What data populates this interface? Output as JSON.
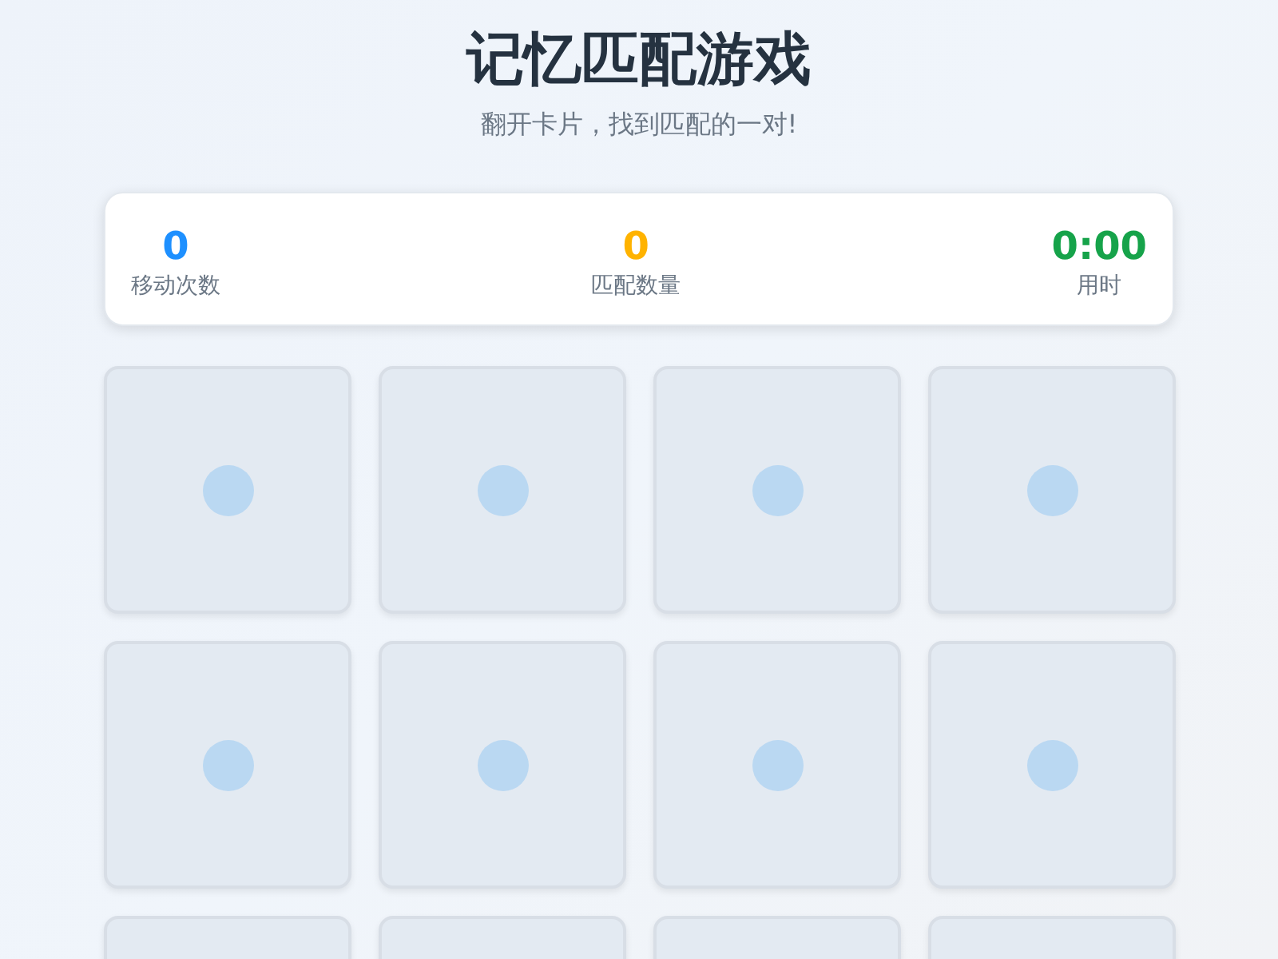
{
  "header": {
    "title": "记忆匹配游戏",
    "subtitle": "翻开卡片，找到匹配的一对!"
  },
  "stats": [
    {
      "value": "0",
      "label": "移动次数",
      "color": "#1e90ff"
    },
    {
      "value": "0",
      "label": "匹配数量",
      "color": "#ffb300"
    },
    {
      "value": "0:00",
      "label": "用时",
      "color": "#16a34a"
    }
  ],
  "cards": [
    {
      "flipped": false
    },
    {
      "flipped": false
    },
    {
      "flipped": false
    },
    {
      "flipped": false
    },
    {
      "flipped": false
    },
    {
      "flipped": false
    },
    {
      "flipped": false
    },
    {
      "flipped": false
    },
    {
      "flipped": false
    },
    {
      "flipped": false
    },
    {
      "flipped": false
    },
    {
      "flipped": false
    }
  ]
}
